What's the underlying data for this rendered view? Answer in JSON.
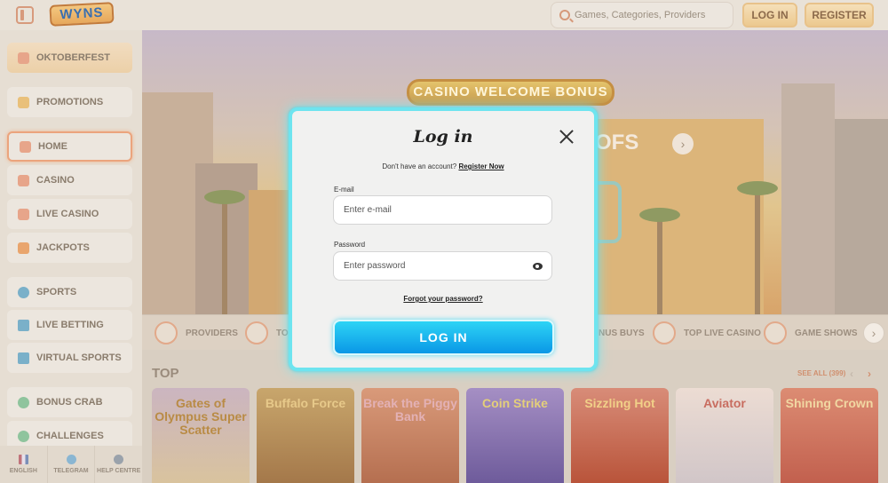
{
  "header": {
    "logo_text": "WYNS",
    "search_placeholder": "Games, Categories, Providers",
    "login_label": "LOG IN",
    "register_label": "REGISTER"
  },
  "sidebar": {
    "items": [
      {
        "label": "OKTOBERFEST",
        "icon": "beer-icon"
      },
      {
        "label": "PROMOTIONS",
        "icon": "gift-icon"
      },
      {
        "label": "HOME",
        "icon": "home-icon"
      },
      {
        "label": "CASINO",
        "icon": "slot-machine-icon"
      },
      {
        "label": "LIVE CASINO",
        "icon": "cards-icon"
      },
      {
        "label": "JACKPOTS",
        "icon": "star-icon"
      },
      {
        "label": "SPORTS",
        "icon": "ball-icon"
      },
      {
        "label": "LIVE BETTING",
        "icon": "live-icon"
      },
      {
        "label": "VIRTUAL SPORTS",
        "icon": "monitor-icon"
      },
      {
        "label": "BONUS CRAB",
        "icon": "crab-icon"
      },
      {
        "label": "CHALLENGES",
        "icon": "trophy-icon"
      }
    ],
    "footer": [
      {
        "label": "ENGLISH",
        "icon": "flag-icon"
      },
      {
        "label": "TELEGRAM",
        "icon": "telegram-icon"
      },
      {
        "label": "HELP CENTRE",
        "icon": "help-icon"
      }
    ]
  },
  "banner": {
    "sign_text": "CASINO WELCOME BONUS",
    "partial_text": "OFS",
    "next_arrow": "›"
  },
  "categories": {
    "items": [
      {
        "label": "PROVIDERS"
      },
      {
        "label": "TO"
      },
      {
        "label": "NUS BUYS"
      },
      {
        "label": "TOP LIVE CASINO"
      },
      {
        "label": "GAME SHOWS"
      }
    ],
    "next_arrow": "›"
  },
  "top_games": {
    "title": "TOP",
    "see_all": "SEE ALL (399)",
    "prev": "‹",
    "next": "›",
    "games": [
      {
        "name": "Gates of Olympus Super Scatter"
      },
      {
        "name": "Buffalo Force"
      },
      {
        "name": "Break the Piggy Bank"
      },
      {
        "name": "Coin Strike"
      },
      {
        "name": "Sizzling Hot"
      },
      {
        "name": "Aviator"
      },
      {
        "name": "Shining Crown"
      }
    ]
  },
  "modal": {
    "title": "Log in",
    "no_account_text": "Don't have an account?",
    "register_link": "Register Now",
    "email_label": "E-mail",
    "email_placeholder": "Enter e-mail",
    "password_label": "Password",
    "password_placeholder": "Enter password",
    "forgot_link": "Forgot your password?",
    "login_button": "LOG IN",
    "accent_color": "#6ee4ef",
    "button_color": "#0a97e6"
  }
}
